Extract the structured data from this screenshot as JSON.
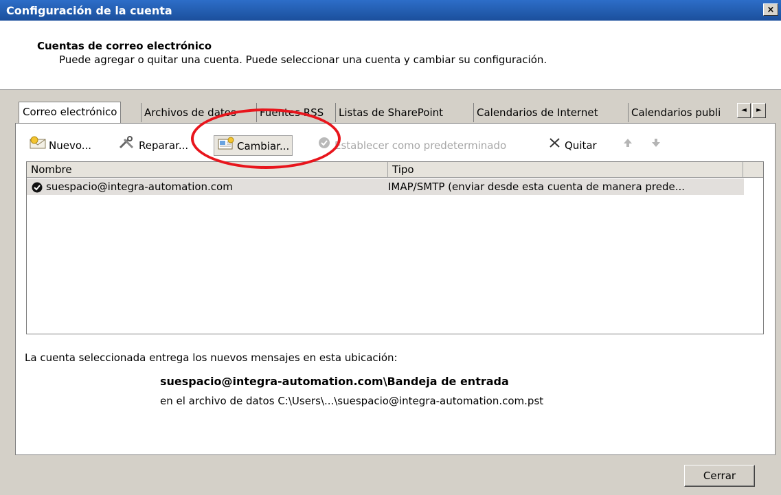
{
  "window": {
    "title": "Configuración de la cuenta",
    "close_glyph": "×"
  },
  "header": {
    "heading": "Cuentas de correo electrónico",
    "description": "Puede agregar o quitar una cuenta. Puede seleccionar una cuenta y cambiar su configuración."
  },
  "tabs": [
    {
      "label": "Correo electrónico",
      "active": true
    },
    {
      "label": "Archivos de datos"
    },
    {
      "label": "Fuentes RSS"
    },
    {
      "label": "Listas de SharePoint"
    },
    {
      "label": "Calendarios de Internet"
    },
    {
      "label": "Calendarios publi"
    }
  ],
  "tab_scroll": {
    "left": "◄",
    "right": "►"
  },
  "toolbar": {
    "nuevo": "Nuevo...",
    "reparar": "Reparar...",
    "cambiar": "Cambiar...",
    "predeterminado": "Establecer como predeterminado",
    "quitar": "Quitar"
  },
  "list": {
    "columns": [
      "Nombre",
      "Tipo"
    ],
    "rows": [
      {
        "name": "suespacio@integra-automation.com",
        "type": "IMAP/SMTP (enviar desde esta cuenta de manera prede..."
      }
    ]
  },
  "delivery": {
    "caption": "La cuenta seleccionada entrega los nuevos mensajes en esta ubicación:",
    "location": "suespacio@integra-automation.com\\Bandeja de entrada",
    "file": "en el archivo de datos C:\\Users\\...\\suespacio@integra-automation.com.pst"
  },
  "buttons": {
    "close": "Cerrar"
  },
  "colors": {
    "titlebar": "#1b4f9c",
    "dialog_bg": "#d4d0c8",
    "highlight_oval": "#e8151c"
  }
}
